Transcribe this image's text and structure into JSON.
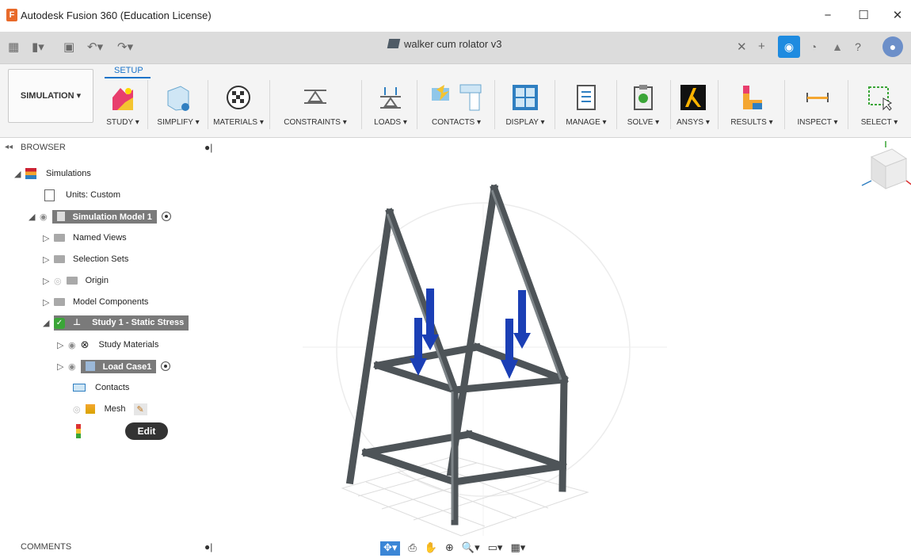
{
  "window": {
    "title": "Autodesk Fusion 360 (Education License)",
    "controls": [
      "−",
      "☐",
      "✕"
    ]
  },
  "document": {
    "tab_title": "walker cum rolator v3"
  },
  "ribbon": {
    "workspace_label": "SIMULATION ▾",
    "active_tab": "SETUP",
    "tools": [
      {
        "label": "STUDY ▾"
      },
      {
        "label": "SIMPLIFY ▾"
      },
      {
        "label": "MATERIALS ▾"
      },
      {
        "label": "CONSTRAINTS ▾"
      },
      {
        "label": "LOADS ▾"
      },
      {
        "label": "CONTACTS ▾"
      },
      {
        "label": "DISPLAY ▾"
      },
      {
        "label": "MANAGE ▾"
      },
      {
        "label": "SOLVE ▾"
      },
      {
        "label": "ANSYS ▾"
      },
      {
        "label": "RESULTS ▾"
      },
      {
        "label": "INSPECT ▾"
      },
      {
        "label": "SELECT ▾"
      }
    ]
  },
  "browser": {
    "title": "BROWSER",
    "collapse_glyph": "◂◂",
    "items": [
      {
        "label": "Simulations"
      },
      {
        "label": "Units: Custom"
      },
      {
        "label": "Simulation Model 1"
      },
      {
        "label": "Named Views"
      },
      {
        "label": "Selection Sets"
      },
      {
        "label": "Origin"
      },
      {
        "label": "Model Components"
      },
      {
        "label": "Study 1 - Static Stress"
      },
      {
        "label": "Study Materials"
      },
      {
        "label": "Load Case1"
      },
      {
        "label": "Contacts"
      },
      {
        "label": "Mesh"
      }
    ],
    "tooltip": "Edit"
  },
  "comments": {
    "title": "COMMENTS"
  },
  "colors": {
    "accent": "#1a73c9",
    "load_arrow": "#1b3fb5",
    "frame": "#5a5f63",
    "study_check": "#3aa537"
  }
}
